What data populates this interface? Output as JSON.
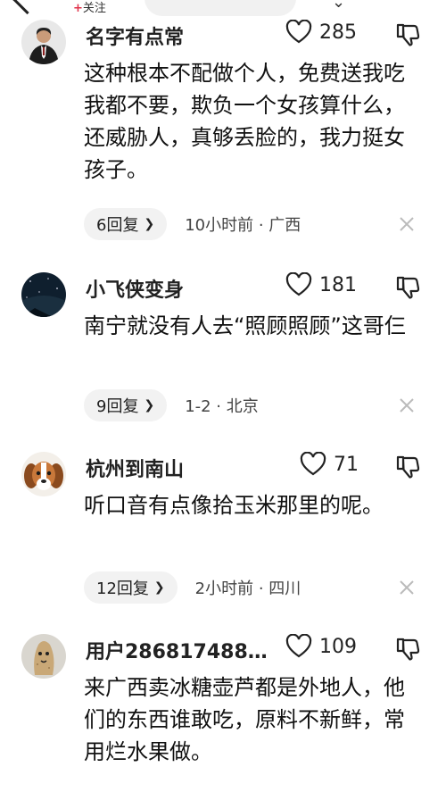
{
  "header": {
    "follow_plus": "+",
    "follow_label": "关注"
  },
  "comments": [
    {
      "username": "名字有点常",
      "likes": "285",
      "text": "这种根本不配做个人，免费送我吃我都不要，欺负一个女孩算什么，还威胁人，真够丢脸的，我力挺女孩子。",
      "replies": "6回复",
      "meta": "10小时前 · 广西",
      "avatar": "person-in-suit-avatar"
    },
    {
      "username": "小飞侠变身",
      "likes": "181",
      "text": "南宁就没有人去“照顾照顾”这哥仨",
      "replies": "9回复",
      "meta": "1-2 · 北京",
      "avatar": "night-sky-avatar"
    },
    {
      "username": "杭州到南山",
      "likes": "71",
      "text": "听口音有点像拾玉米那里的呢。",
      "replies": "12回复",
      "meta": "2小时前 · 四川",
      "avatar": "puppy-avatar"
    },
    {
      "username": "用户286817488…",
      "likes": "109",
      "text": "来广西卖冰糖壶芦都是外地人，他们的东西谁敢吃，原料不新鲜，常用烂水果做。",
      "avatar": "cartoon-potato-avatar"
    }
  ]
}
